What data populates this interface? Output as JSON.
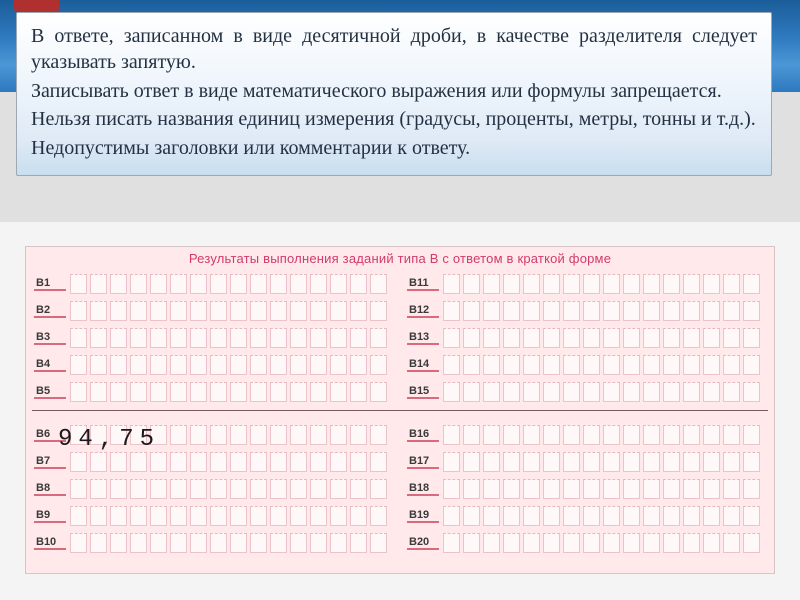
{
  "info": {
    "p1": "В ответе, записанном в виде десятичной дроби, в качестве разделителя  следует указывать запятую.",
    "p2": "Записывать ответ в виде математического выражения или формулы запрещается.",
    "p3": "Нельзя писать названия единиц измерения  (градусы, проценты, метры, тонны и т.д.).",
    "p4": "Недопустимы заголовки или комментарии к ответу."
  },
  "form": {
    "title": "Результаты выполнения заданий типа В с ответом в краткой форме",
    "cells_per_row": 16,
    "left_labels_top": [
      "В1",
      "В2",
      "В3",
      "В4",
      "В5"
    ],
    "right_labels_top": [
      "В11",
      "В12",
      "В13",
      "В14",
      "В15"
    ],
    "left_labels_bot": [
      "В6",
      "В7",
      "В8",
      "В9",
      "В10"
    ],
    "right_labels_bot": [
      "В16",
      "В17",
      "В18",
      "В19",
      "В20"
    ]
  },
  "example_answer": "94,75"
}
